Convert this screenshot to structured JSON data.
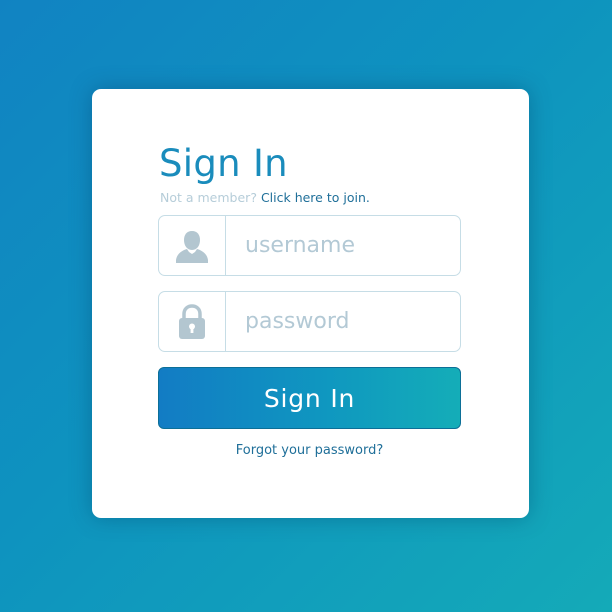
{
  "colors": {
    "background_start": "#1183c2",
    "background_end": "#14aab8",
    "title": "#1a8cbc",
    "link": "#1f6f99",
    "muted_text": "#b6cdd9",
    "field_border": "#c6dde6",
    "icon": "#b3c6d0",
    "button_start": "#127cc4",
    "button_end": "#14adb8",
    "button_text": "#ffffff"
  },
  "login": {
    "title": "Sign In",
    "join_prompt": "Not a member?",
    "join_link": "Click here to join.",
    "username": {
      "icon": "user-icon",
      "placeholder": "username",
      "value": ""
    },
    "password": {
      "icon": "lock-icon",
      "placeholder": "password",
      "value": ""
    },
    "submit_label": "Sign In",
    "forgot_link": "Forgot your password?"
  }
}
